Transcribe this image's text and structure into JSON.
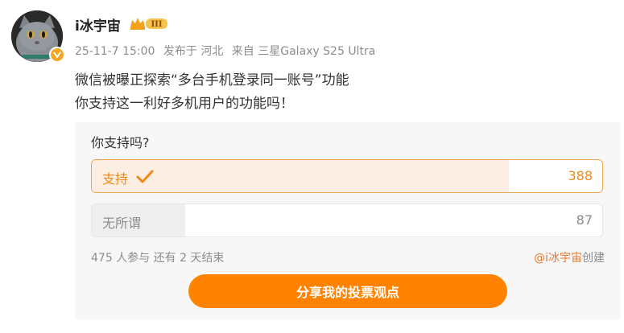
{
  "user": {
    "name": "i冰宇宙",
    "level_badge": "III"
  },
  "meta": {
    "date": "25-11-7 15:00",
    "location": "发布于 河北",
    "device": "来自 三星Galaxy S25 Ultra"
  },
  "post": {
    "line1": "微信被曝正探索“多台手机登录同一账号”功能",
    "line2": "你支持这一利好多机用户的功能吗！"
  },
  "poll": {
    "question": "你支持吗?",
    "total_votes": 475,
    "options": [
      {
        "label": "支持",
        "count": "388",
        "share": 0.8168,
        "selected": true
      },
      {
        "label": "无所谓",
        "count": "87",
        "share": 0.1832,
        "selected": false
      }
    ],
    "footer": "475 人参与  还有 2 天结束",
    "creator_handle": "@i冰宇宙",
    "creator_suffix": "创建",
    "share_button": "分享我的投票观点"
  },
  "colors": {
    "accent": "#ff8200",
    "selected_text": "#f08a14",
    "selected_fill": "#fdeee4"
  }
}
